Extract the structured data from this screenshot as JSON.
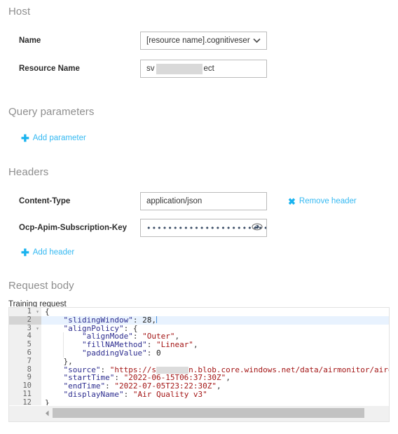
{
  "sections": {
    "host": "Host",
    "query_parameters": "Query parameters",
    "headers": "Headers",
    "request_body": "Request body"
  },
  "host": {
    "name_label": "Name",
    "name_value": "[resource name].cognitiveser",
    "name_options": [
      "[resource name].cognitiveser"
    ],
    "resource_name_label": "Resource Name",
    "resource_name_prefix": "sv",
    "resource_name_suffix": "ect"
  },
  "query_parameters": {
    "add_label": "Add parameter",
    "add_icon": "plus-icon"
  },
  "headers": {
    "rows": [
      {
        "label": "Content-Type",
        "value": "application/json",
        "type": "text",
        "remove_label": "Remove header",
        "remove_icon": "close-x-icon"
      },
      {
        "label": "Ocp-Apim-Subscription-Key",
        "value": "••••••••••••••••••••••••••••••",
        "type": "password",
        "reveal_icon": "eye-icon"
      }
    ],
    "add_label": "Add header",
    "add_icon": "plus-icon"
  },
  "request_body": {
    "editor_label": "Training request",
    "scroll_left_icon": "triangle-left-icon",
    "code_lines": [
      {
        "num": "1",
        "fold": true,
        "indent": 0,
        "segments": [
          {
            "t": "punct",
            "v": "{"
          }
        ]
      },
      {
        "num": "2",
        "fold": false,
        "indent": 0,
        "active": true,
        "segments": [
          {
            "t": "key",
            "v": "    \"slidingWindow\""
          },
          {
            "t": "punct",
            "v": ": "
          },
          {
            "t": "num",
            "v": "28"
          },
          {
            "t": "punct",
            "v": ","
          }
        ],
        "caret": true
      },
      {
        "num": "3",
        "fold": true,
        "indent": 0,
        "segments": [
          {
            "t": "key",
            "v": "    \"alignPolicy\""
          },
          {
            "t": "punct",
            "v": ": {"
          }
        ]
      },
      {
        "num": "4",
        "fold": false,
        "indent": 1,
        "segments": [
          {
            "t": "key",
            "v": "        \"alignMode\""
          },
          {
            "t": "punct",
            "v": ": "
          },
          {
            "t": "str",
            "v": "\"Outer\""
          },
          {
            "t": "punct",
            "v": ","
          }
        ]
      },
      {
        "num": "5",
        "fold": false,
        "indent": 1,
        "segments": [
          {
            "t": "key",
            "v": "        \"fillNAMethod\""
          },
          {
            "t": "punct",
            "v": ": "
          },
          {
            "t": "str",
            "v": "\"Linear\""
          },
          {
            "t": "punct",
            "v": ","
          }
        ]
      },
      {
        "num": "6",
        "fold": false,
        "indent": 1,
        "segments": [
          {
            "t": "key",
            "v": "        \"paddingValue\""
          },
          {
            "t": "punct",
            "v": ": "
          },
          {
            "t": "num",
            "v": "0"
          }
        ]
      },
      {
        "num": "7",
        "fold": false,
        "indent": 0,
        "segments": [
          {
            "t": "punct",
            "v": "    },"
          }
        ]
      },
      {
        "num": "8",
        "fold": false,
        "indent": 0,
        "segments": [
          {
            "t": "key",
            "v": "    \"source\""
          },
          {
            "t": "punct",
            "v": ": "
          },
          {
            "t": "str",
            "v": "\"https://s"
          },
          {
            "t": "redact",
            "v": "       "
          },
          {
            "t": "str",
            "v": "n.blob.core.windows.net/data/airmonitor/airquality-training.zip?sp=r"
          }
        ]
      },
      {
        "num": "9",
        "fold": false,
        "indent": 0,
        "segments": [
          {
            "t": "key",
            "v": "    \"startTime\""
          },
          {
            "t": "punct",
            "v": ": "
          },
          {
            "t": "str",
            "v": "\"2022-06-15T06:37:30Z\""
          },
          {
            "t": "punct",
            "v": ","
          }
        ]
      },
      {
        "num": "10",
        "fold": false,
        "indent": 0,
        "segments": [
          {
            "t": "key",
            "v": "    \"endTime\""
          },
          {
            "t": "punct",
            "v": ": "
          },
          {
            "t": "str",
            "v": "\"2022-07-05T23:22:30Z\""
          },
          {
            "t": "punct",
            "v": ","
          }
        ]
      },
      {
        "num": "11",
        "fold": false,
        "indent": 0,
        "segments": [
          {
            "t": "key",
            "v": "    \"displayName\""
          },
          {
            "t": "punct",
            "v": ": "
          },
          {
            "t": "str",
            "v": "\"Air Quality v3\""
          }
        ]
      },
      {
        "num": "12",
        "fold": false,
        "indent": 0,
        "segments": [
          {
            "t": "punct",
            "v": "}"
          }
        ]
      }
    ]
  },
  "colors": {
    "link": "#35b9f2",
    "icon": "#19b3ef",
    "heading": "#8e8e8e",
    "border": "#bbbbbb",
    "active_line": "#e8f2fe",
    "gutter": "#f0f0f0",
    "json_key": "#2d2d8f",
    "json_string": "#a31515"
  }
}
